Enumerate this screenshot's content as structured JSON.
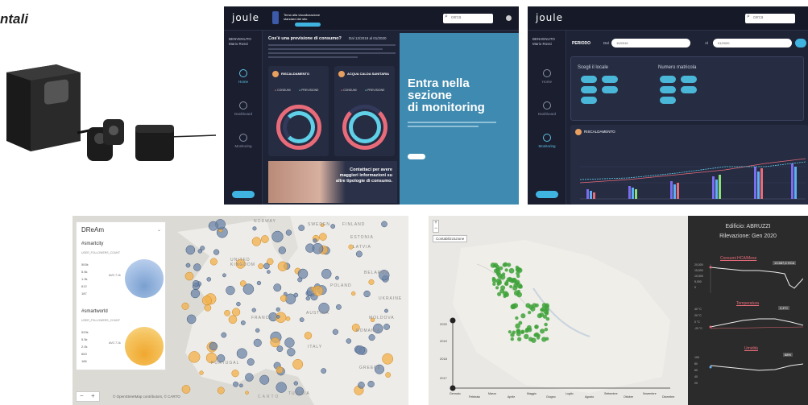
{
  "section_title": "ntali",
  "dashboard1": {
    "logo": "joule",
    "notice_title": "Tema alla visualizzazione standard del sito",
    "search_placeholder": "cerca",
    "user_greeting": "BENVENUTO",
    "user_name": "Mario Rossi",
    "sidebar": [
      "Home",
      "Dashboard",
      "Monitoring"
    ],
    "question": "Cos'è una previsione di consumo?",
    "date_range": "Dal 12/2019 al 01/2020",
    "cards": [
      {
        "title": "RISCALDAMENTO",
        "legend": [
          "CONSUMI",
          "PREVISIONE"
        ]
      },
      {
        "title": "ACQUA CALDA SANITARIA",
        "legend": [
          "CONSUMI",
          "PREVISIONE"
        ]
      }
    ],
    "blue_panel_title": "Entra nella\nsezione\ndi monitoring",
    "promo_text": "Contattaci per avere maggiori informazioni su altre tipologie di consumo."
  },
  "dashboard2": {
    "logo": "joule",
    "search_placeholder": "cerca",
    "user_greeting": "BENVENUTO",
    "user_name": "Mario Rossi",
    "sidebar": [
      "Home",
      "Dashboard",
      "Monitoring"
    ],
    "period_label": "PERIODO",
    "from_label": "Dal",
    "from_value": "10/2019",
    "to_label": "Al",
    "to_value": "01/2020",
    "choose_locale": "Scegli il locale",
    "serial_number": "Numero matricola",
    "chart_title": "RISCALDAMENTO"
  },
  "map1": {
    "panel_title": "DReAm",
    "tag1": "#smartcity",
    "tag2": "#smartworld",
    "metric": "USER_FOLLOWERS_COUNT",
    "scale1": [
      "500k",
      "5.5k",
      "1.9k",
      "612",
      "187"
    ],
    "scale2": [
      "520k",
      "5.5k",
      "2.0k",
      "663",
      "186"
    ],
    "avg": "AVG 7.1k",
    "labels": [
      "NORWAY",
      "SWEDEN",
      "FINLAND",
      "ESTONIA",
      "LATVIA",
      "UNITED KINGDOM",
      "BELARUS",
      "POLAND",
      "UKRAINE",
      "MOLDOVA",
      "FRANCE",
      "AUSTRIA",
      "ROMANIA",
      "PORTUGAL",
      "ITALY",
      "GREECE",
      "TUNISIA",
      "CARTO"
    ],
    "attribution": "© OpenStreetMap contributors, © CARTO"
  },
  "map2": {
    "layer_label": "Contabilizzazione",
    "years": [
      "2020",
      "2019",
      "2018",
      "2017"
    ],
    "months": [
      "Gennaio",
      "Febbraio",
      "Marzo",
      "Aprile",
      "Maggio",
      "Giugno",
      "Luglio",
      "Agosto",
      "Settembre",
      "Ottobre",
      "Novembre",
      "Dicembre"
    ]
  },
  "detail": {
    "building": "Edificio: ABRUZZI",
    "survey": "Rilevazione: Gen 2020",
    "chart1_title": "Consumi HCA/Mese",
    "chart1_badge": "13.587,6 HCA",
    "chart1_ticks": [
      "20,000",
      "15,000",
      "10,000",
      "5,000",
      "0"
    ],
    "chart2_title": "Temperatura",
    "chart2_badge": "2,4°C",
    "chart2_ticks": [
      "40 °C",
      "20 °C",
      "0 °C",
      "-20 °C"
    ],
    "chart3_title": "Umidità",
    "chart3_badge": "68%",
    "chart3_ticks": [
      "100",
      "80",
      "60",
      "40",
      "20"
    ]
  },
  "colors": {
    "dark_bg": "#1e2336",
    "accent": "#3fb4e0",
    "pink": "#e86b7a",
    "cyan": "#5fd0e8",
    "blue_panel": "#3f8ab0"
  }
}
